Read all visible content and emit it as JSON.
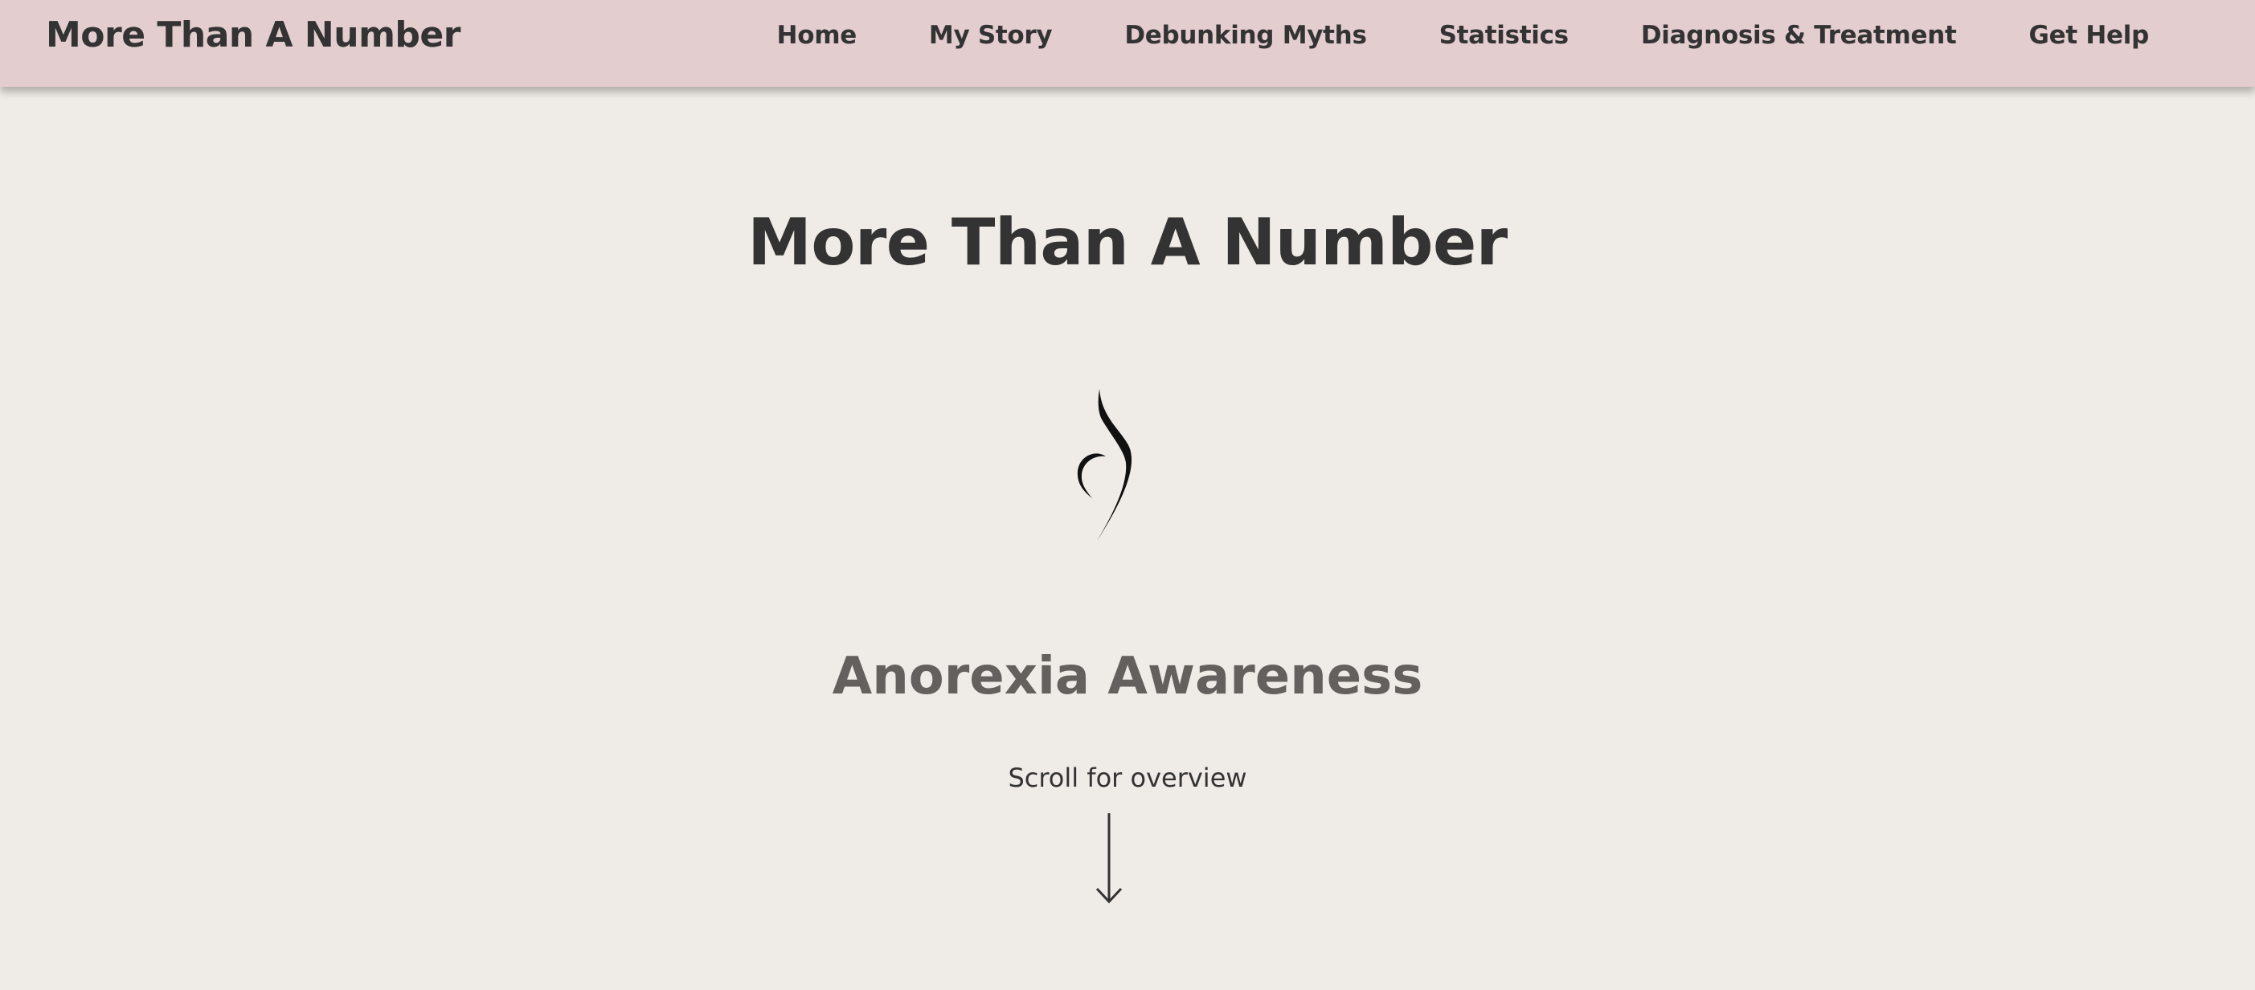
{
  "nav": {
    "brand": "More Than A Number",
    "links": [
      "Home",
      "My Story",
      "Debunking Myths",
      "Statistics",
      "Diagnosis & Treatment",
      "Get Help"
    ]
  },
  "hero": {
    "title": "More Than A Number",
    "logo_icon": "silhouette-logo-icon",
    "subtitle": "Anorexia Awareness",
    "scroll_text": "Scroll for overview",
    "arrow_icon": "arrow-down-icon"
  },
  "colors": {
    "nav_background": "#e3cdce",
    "page_background": "#efebe6",
    "text_dark": "#333333",
    "subtitle_gray": "#64605d"
  }
}
